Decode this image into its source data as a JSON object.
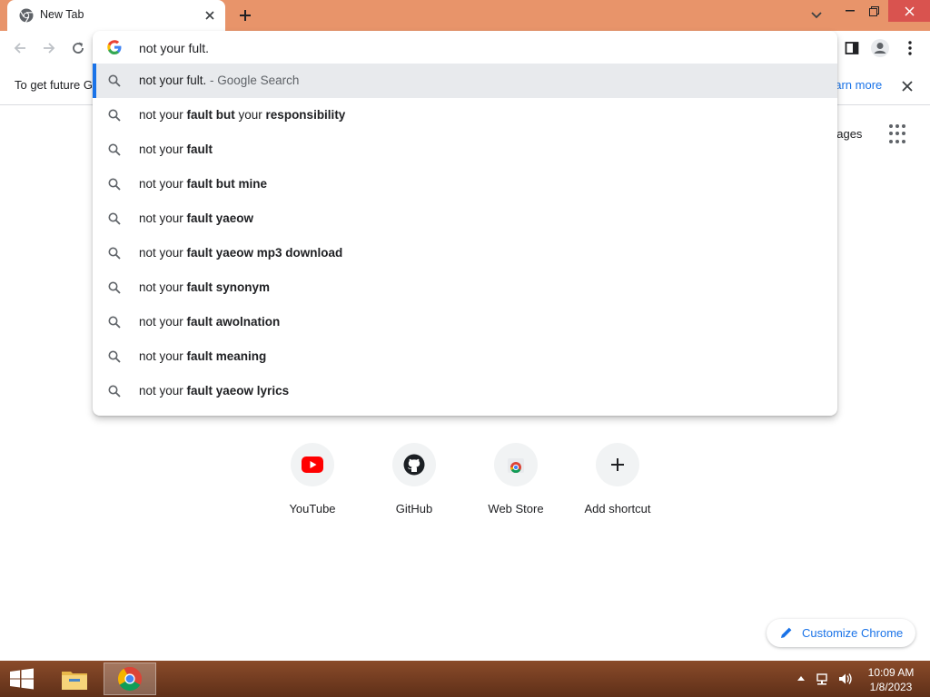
{
  "window": {
    "tab_title": "New Tab",
    "new_tab_symbol": "+"
  },
  "toolbar": {
    "omnibox_value": "not your fult."
  },
  "infobar": {
    "message": "To get future G",
    "learn_more": "earn more"
  },
  "suggestions": [
    {
      "normal": "not your fult.",
      "bold": "",
      "rest": " - Google Search",
      "selected": true
    },
    {
      "normal": "not your ",
      "bold": "fault but",
      "rest": " your ",
      "bold2": "responsibility"
    },
    {
      "normal": "not your ",
      "bold": "fault"
    },
    {
      "normal": "not your ",
      "bold": "fault but mine"
    },
    {
      "normal": "not your ",
      "bold": "fault yaeow"
    },
    {
      "normal": "not your ",
      "bold": "fault yaeow mp3 download"
    },
    {
      "normal": "not your ",
      "bold": "fault synonym"
    },
    {
      "normal": "not your ",
      "bold": "fault awolnation"
    },
    {
      "normal": "not your ",
      "bold": "fault meaning"
    },
    {
      "normal": "not your ",
      "bold": "fault yaeow lyrics"
    }
  ],
  "ntp": {
    "images_link": "nages",
    "shortcuts": [
      {
        "label": "YouTube",
        "icon": "youtube-icon"
      },
      {
        "label": "GitHub",
        "icon": "github-icon"
      },
      {
        "label": "Web Store",
        "icon": "web-store-icon"
      },
      {
        "label": "Add shortcut",
        "icon": "plus-icon"
      }
    ],
    "customize_label": "Customize Chrome"
  },
  "taskbar": {
    "time": "10:09 AM",
    "date": "1/8/2023"
  },
  "colors": {
    "titlebar": "#e8946a",
    "accent": "#1a73e8",
    "taskbar": "#6e3a20"
  }
}
